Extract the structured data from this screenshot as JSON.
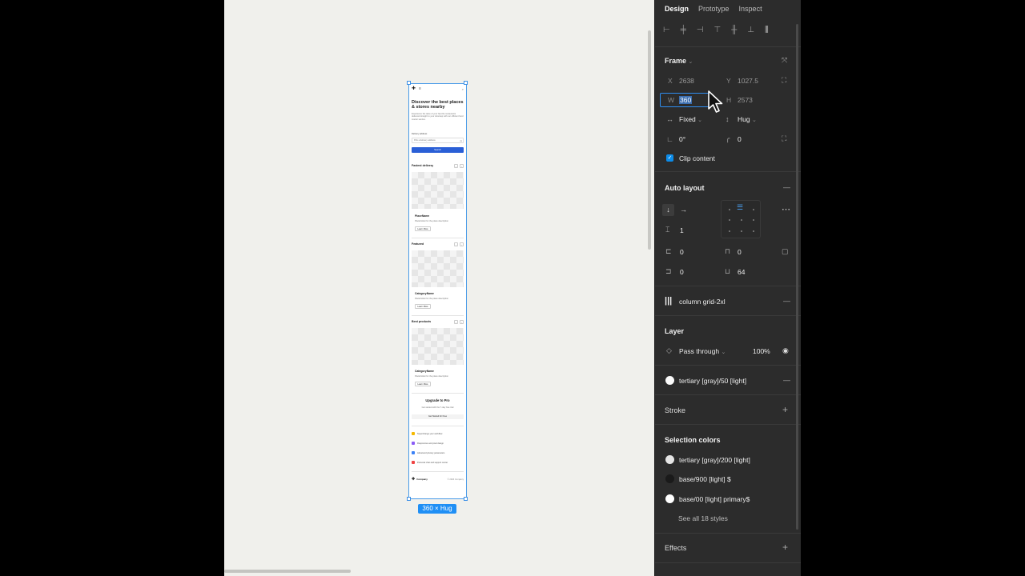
{
  "frame": {
    "hero": {
      "title": "Discover the best places & stores nearby",
      "subtitle": "Experience the taste of your favorite restaurants delivered straight to your doorstep with our efficient food courier service.",
      "address_label": "Delivery address",
      "address_placeholder": "Pick a delivery address",
      "search_button": "Search"
    },
    "sections": [
      {
        "title": "Fastest delivery",
        "card_title": "PlaceName",
        "card_desc": "Placeholder for the place description",
        "button": "Learn More"
      },
      {
        "title": "Featured",
        "card_title": "CategoryName",
        "card_desc": "Placeholder for the place description",
        "button": "Learn More"
      },
      {
        "title": "Best products",
        "card_title": "CategoryName",
        "card_desc": "Placeholder for the place description",
        "button": "Learn More"
      }
    ],
    "upgrade": {
      "title": "Upgrade to Pro",
      "subtitle": "Get started with the 7-day free trial",
      "button": "Get Started for Free"
    },
    "features": [
      {
        "text": "Supercharge your workflow",
        "color": "#f5b800"
      },
      {
        "text": "Responsive and pixel design",
        "color": "#8b5cf6"
      },
      {
        "text": "Advanced privacy parameters",
        "color": "#3b82f6"
      },
      {
        "text": "Personal chat and support center",
        "color": "#ef4444"
      }
    ],
    "footer": {
      "company": "Company",
      "copyright": "© 2024 Company"
    },
    "size_badge": "360 × Hug"
  },
  "panel": {
    "tabs": [
      "Design",
      "Prototype",
      "Inspect"
    ],
    "frame_section": {
      "title": "Frame",
      "x_label": "X",
      "x_value": "2638",
      "y_label": "Y",
      "y_value": "1027.5",
      "w_label": "W",
      "w_value": "360",
      "h_label": "H",
      "h_value": "2573",
      "width_mode": "Fixed",
      "height_mode": "Hug",
      "rotation": "0°",
      "radius": "0",
      "clip_content": "Clip content"
    },
    "auto_layout": {
      "title": "Auto layout",
      "gap": "1",
      "pad_left": "0",
      "pad_top": "0",
      "pad_right": "0",
      "pad_bottom": "64"
    },
    "grid": {
      "name": "column grid-2xl"
    },
    "layer": {
      "title": "Layer",
      "blend": "Pass through",
      "opacity": "100%"
    },
    "fill": {
      "name": "tertiary [gray]/50 [light]"
    },
    "stroke": {
      "title": "Stroke"
    },
    "selection_colors": {
      "title": "Selection colors",
      "items": [
        {
          "name": "tertiary [gray]/200 [light]",
          "color": "#e5e5e5"
        },
        {
          "name": "base/900 [light] $",
          "color": "#1a1a1a"
        },
        {
          "name": "base/00 [light] primary$",
          "color": "#ffffff"
        }
      ],
      "see_all": "See all 18 styles"
    },
    "effects": {
      "title": "Effects"
    }
  }
}
